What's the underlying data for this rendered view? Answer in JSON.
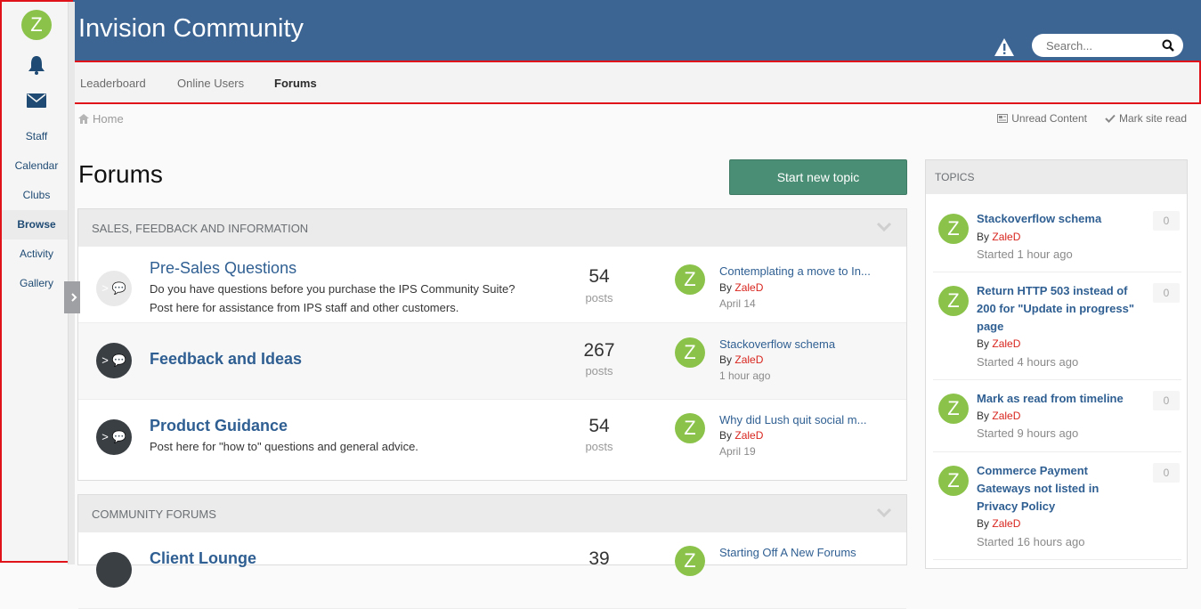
{
  "sidebar": {
    "avatar_letter": "Z",
    "bell_icon": "bell-icon",
    "mail_icon": "envelope-icon",
    "items": [
      {
        "label": "Staff"
      },
      {
        "label": "Calendar"
      },
      {
        "label": "Clubs"
      },
      {
        "label": "Browse",
        "active": true
      },
      {
        "label": "Activity"
      },
      {
        "label": "Gallery"
      }
    ],
    "collapse_icon": "chevron-right-icon"
  },
  "header": {
    "title": "Invision Community",
    "alert_icon": "warning-icon",
    "search_placeholder": "Search...",
    "search_icon": "search-icon"
  },
  "nav": {
    "tabs": [
      {
        "label": "Leaderboard"
      },
      {
        "label": "Online Users"
      },
      {
        "label": "Forums",
        "active": true
      }
    ]
  },
  "breadcrumb": {
    "home": "Home"
  },
  "actions": {
    "unread": "Unread Content",
    "mark_read": "Mark site read"
  },
  "main": {
    "title": "Forums",
    "new_topic": "Start new topic"
  },
  "categories": [
    {
      "title": "SALES, FEEDBACK AND INFORMATION",
      "forums": [
        {
          "title": "Pre-Sales Questions",
          "desc": "Do you have questions before you purchase the IPS Community Suite? Post here for assistance from IPS staff and other customers.",
          "count": "54",
          "posts_label": "posts",
          "last_title": "Contemplating a move to In...",
          "last_by_prefix": "By",
          "last_user": "ZaleD",
          "last_date": "April 14",
          "avatar_letter": "Z",
          "icon_label": "> 💬"
        },
        {
          "title": "Feedback and Ideas",
          "desc": "",
          "count": "267",
          "posts_label": "posts",
          "last_title": "Stackoverflow schema",
          "last_by_prefix": "By",
          "last_user": "ZaleD",
          "last_date": "1 hour ago",
          "avatar_letter": "Z",
          "icon_label": "> 💬"
        },
        {
          "title": "Product Guidance",
          "desc": "Post here for \"how to\" questions and general advice.",
          "count": "54",
          "posts_label": "posts",
          "last_title": "Why did Lush quit social m...",
          "last_by_prefix": "By",
          "last_user": "ZaleD",
          "last_date": "April 19",
          "avatar_letter": "Z",
          "icon_label": "> 💬"
        }
      ]
    },
    {
      "title": "COMMUNITY FORUMS",
      "forums": [
        {
          "title": "Client Lounge",
          "count": "39",
          "last_title": "Starting Off A New Forums",
          "avatar_letter": "Z"
        }
      ]
    }
  ],
  "topics": {
    "title": "TOPICS",
    "items": [
      {
        "title": "Stackoverflow schema",
        "by_prefix": "By",
        "user": "ZaleD",
        "date": "Started 1 hour ago",
        "count": "0",
        "avatar": "Z"
      },
      {
        "title": "Return HTTP 503 instead of 200 for \"Update in progress\" page",
        "by_prefix": "By",
        "user": "ZaleD",
        "date": "Started 4 hours ago",
        "count": "0",
        "avatar": "Z"
      },
      {
        "title": "Mark as read from timeline",
        "by_prefix": "By",
        "user": "ZaleD",
        "date": "Started 9 hours ago",
        "count": "0",
        "avatar": "Z"
      },
      {
        "title": "Commerce Payment Gateways not listed in Privacy Policy",
        "by_prefix": "By",
        "user": "ZaleD",
        "date": "Started 16 hours ago",
        "count": "0",
        "avatar": "Z"
      }
    ]
  },
  "colors": {
    "header": "#3d6594",
    "accent_button": "#4a8f75",
    "link": "#2f5f92",
    "user": "#d8251e",
    "avatar": "#8bc34a",
    "highlight_border": "#e0121a"
  }
}
